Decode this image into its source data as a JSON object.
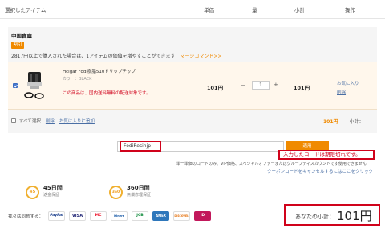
{
  "header": {
    "col_item": "選択したアイテム",
    "col_price": "単価",
    "col_qty": "量",
    "col_subtotal": "小計",
    "col_action": "操作"
  },
  "warehouse": {
    "title": "中国倉庫",
    "badge": "割引",
    "promo_text": "2817円以上で購入された場合は、1アイテムの価値を増やすことができます",
    "promo_link": "マージコマンド>>"
  },
  "item": {
    "name": "Hcigar Fodi樹脂510ドリップチップ",
    "color": "カラー：BLACK",
    "warning": "この商品は、国内送料無料の配送対象です。",
    "price": "101円",
    "quantity": "1",
    "subtotal": "101円",
    "favorite_link": "お気に入り",
    "delete_link": "削除"
  },
  "footer": {
    "select_all": "すべて選択",
    "delete": "削除",
    "add_favorites": "お気に入りに追加",
    "total": "101円",
    "subtotal_label": "小計："
  },
  "coupon": {
    "value": "FodiResinjp",
    "apply_label": "適用",
    "error": "入力したコードは期限切れです。",
    "note": "単一単価のコードのみ、VIP価格、スペシャルオファーまたはグループディスカウントです使用できません",
    "cancel_link": "クーポンコードをキャンセルするにはここをクリック"
  },
  "guarantees": [
    {
      "badge": "45",
      "title": "45日間",
      "sub": "返金保証"
    },
    {
      "badge": "360",
      "title": "360日間",
      "sub": "無償修理保証"
    }
  ],
  "payment": {
    "label": "我々は同意する：",
    "methods": [
      "PayPal",
      "VISA",
      "MC",
      "Diners",
      "JCB",
      "AMEX",
      "DISCOVER",
      "iD"
    ]
  },
  "total": {
    "label": "あなたの小計：",
    "value": "101円"
  },
  "colors": {
    "accent": "#f08a00",
    "error": "#d0021b",
    "link": "#4a6fa5"
  }
}
